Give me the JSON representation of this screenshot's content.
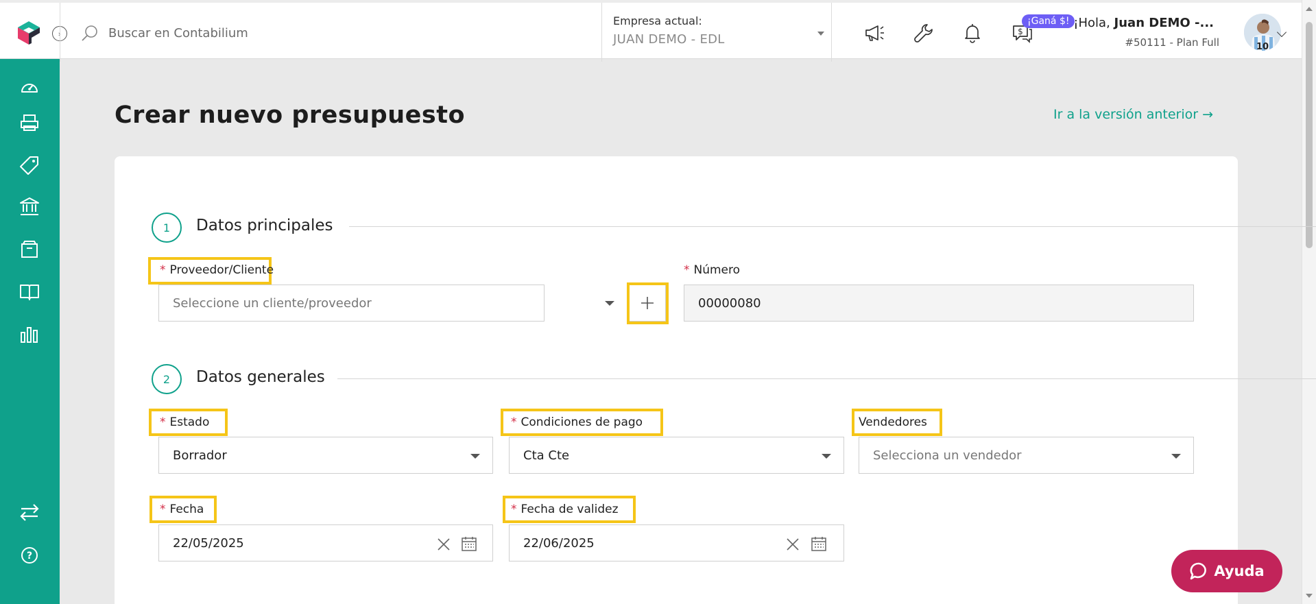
{
  "topbar": {
    "search_placeholder": "Buscar en Contabilium",
    "company_label": "Empresa actual:",
    "company_value": "JUAN DEMO - EDL",
    "badge": "¡Ganá $!",
    "greeting_prefix": "¡Hola, ",
    "greeting_name": "Juan DEMO -...",
    "plan": "#50111 - Plan Full",
    "icons": [
      "megaphone-icon",
      "wrench-icon",
      "bell-icon",
      "chat-money-icon"
    ]
  },
  "sidebar": {
    "items": [
      "dashboard-icon",
      "printer-icon",
      "tag-icon",
      "bank-icon",
      "box-icon",
      "book-icon",
      "chart-icon"
    ],
    "bottom": [
      "transfer-icon",
      "help-icon"
    ]
  },
  "page": {
    "title": "Crear nuevo presupuesto",
    "prev_link": "Ir a la versión anterior →"
  },
  "sections": {
    "main": {
      "num": "1",
      "title": "Datos principales"
    },
    "general": {
      "num": "2",
      "title": "Datos generales"
    }
  },
  "form": {
    "required_mark": "*",
    "proveedor": {
      "label": "Proveedor/Cliente",
      "placeholder": "Seleccione un cliente/proveedor"
    },
    "numero": {
      "label": "Número",
      "value": "00000080"
    },
    "estado": {
      "label": "Estado",
      "value": "Borrador"
    },
    "condiciones": {
      "label": "Condiciones de pago",
      "value": "Cta Cte"
    },
    "vendedores": {
      "label": "Vendedores",
      "placeholder": "Selecciona un vendedor"
    },
    "fecha": {
      "label": "Fecha",
      "value": "22/05/2025"
    },
    "fecha_validez": {
      "label": "Fecha de validez",
      "value": "22/06/2025"
    }
  },
  "help": {
    "label": "Ayuda"
  },
  "colors": {
    "brand": "#0fa18b",
    "required": "#d32f48",
    "highlight": "#f5c518",
    "help": "#c2245a",
    "badge": "#6d5ef5"
  }
}
